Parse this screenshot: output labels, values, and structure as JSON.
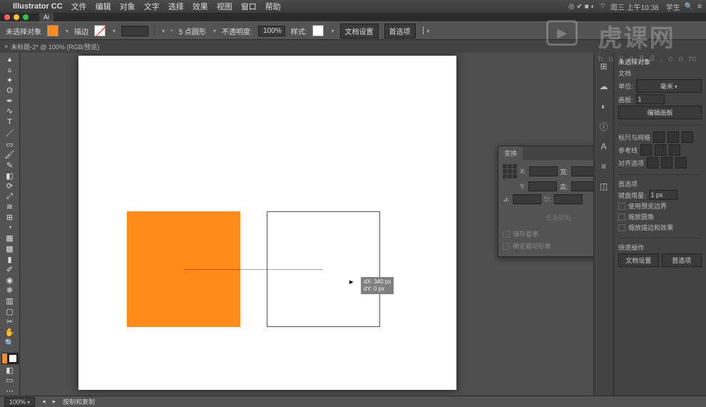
{
  "menubar": {
    "app_name": "Illustrator CC",
    "items": [
      "文件",
      "编辑",
      "对象",
      "文字",
      "选择",
      "效果",
      "视图",
      "窗口",
      "帮助"
    ],
    "right_status": "周三 上午10:38　学生"
  },
  "window": {
    "tab_label": "Ai"
  },
  "control_bar": {
    "selection_status": "未选择对象",
    "stroke_label": "描边",
    "stroke_weight": "",
    "shape_label": "5 点圆形",
    "opacity_label": "不透明度:",
    "opacity_value": "100%",
    "style_label": "样式:",
    "doc_setup": "文档设置",
    "preferences": "首选项"
  },
  "doc_tab": {
    "label": "未标题-2* @ 100% (RGB/预览)"
  },
  "canvas": {
    "hint_dx": "dX: 340 px",
    "hint_dy": "dY: 0 px"
  },
  "float_panel": {
    "tab1": "变换",
    "reset_label": "无法拼贴",
    "chk1": "储存着事",
    "chk2": "确定着动形象"
  },
  "props": {
    "title": "未选择对象",
    "doc_label": "文档",
    "units_label": "单位:",
    "units_value": "毫米",
    "artboard_label": "画板:",
    "artboard_value": "1",
    "edit_artboard": "编辑画板",
    "ruler_grid_label": "标尺与网格",
    "guides_label": "参考线",
    "snap_label": "对齐选项",
    "prefs_label": "首选项",
    "key_inc_label": "键盘增量:",
    "key_inc_value": "1 px",
    "chk1": "使用预览边界",
    "chk2": "缩放圆角",
    "chk3": "缩放描边和效果",
    "quick_label": "快速操作",
    "doc_setup_btn": "文档设置",
    "prefs_btn": "首选项"
  },
  "status": {
    "zoom": "100%",
    "tool_hint": "按制和复制"
  },
  "watermark": {
    "main": "虎课网",
    "sub": "huke88.com"
  }
}
